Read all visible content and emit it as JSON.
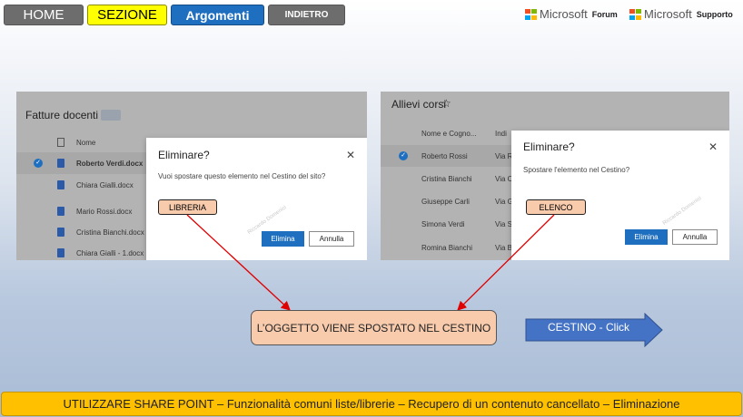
{
  "nav": {
    "home": "HOME",
    "sezione": "SEZIONE",
    "argomenti": "Argomenti",
    "indietro": "INDIETRO"
  },
  "links": {
    "microsoft": "Microsoft",
    "forum": "Forum",
    "supporto": "Supporto",
    "logo_colors": [
      "#f25022",
      "#7fba00",
      "#00a4ef",
      "#ffb900"
    ]
  },
  "left_shot": {
    "title": "Fatture docenti",
    "column_name": "Nome",
    "files": [
      "Roberto Verdi.docx",
      "Chiara Gialli.docx",
      "Mario Rossi.docx",
      "Cristina Bianchi.docx",
      "Chiara Gialli - 1.docx"
    ],
    "dialog": {
      "title": "Eliminare?",
      "close": "✕",
      "message": "Vuoi spostare questo elemento nel Cestino del sito?",
      "confirm": "Elimina",
      "cancel": "Annulla",
      "watermark": "Riccardo Domenici"
    },
    "tag": "LIBRERIA"
  },
  "right_shot": {
    "title": "Allievi corsi",
    "star": "☆",
    "column_name": "Nome e Cogno...",
    "column_address": "Indi",
    "rows": [
      {
        "name": "Roberto Rossi",
        "address": "Via R"
      },
      {
        "name": "Cristina Bianchi",
        "address": "Via C"
      },
      {
        "name": "Giuseppe Carli",
        "address": "Via G"
      },
      {
        "name": "Simona Verdi",
        "address": "Via S"
      },
      {
        "name": "Romina Bianchi",
        "address": "Via B"
      }
    ],
    "dialog": {
      "title": "Eliminare?",
      "close": "✕",
      "message": "Spostare l'elemento nel Cestino?",
      "confirm": "Elimina",
      "cancel": "Annulla",
      "watermark": "Riccardo Domenici"
    },
    "tag": "ELENCO"
  },
  "central": "L’OGGETTO VIENE SPOSTATO NEL CESTINO",
  "cestino_button": "CESTINO - Click",
  "footer": "UTILIZZARE SHARE POINT – Funzionalità comuni liste/librerie – Recupero di un contenuto cancellato – Eliminazione",
  "colors": {
    "accent_blue": "#1f6fc1",
    "tag_fill": "#f8cbad",
    "footer_fill": "#ffc000",
    "arrow_red": "#e00000",
    "sezione_fill": "#ffff00"
  }
}
